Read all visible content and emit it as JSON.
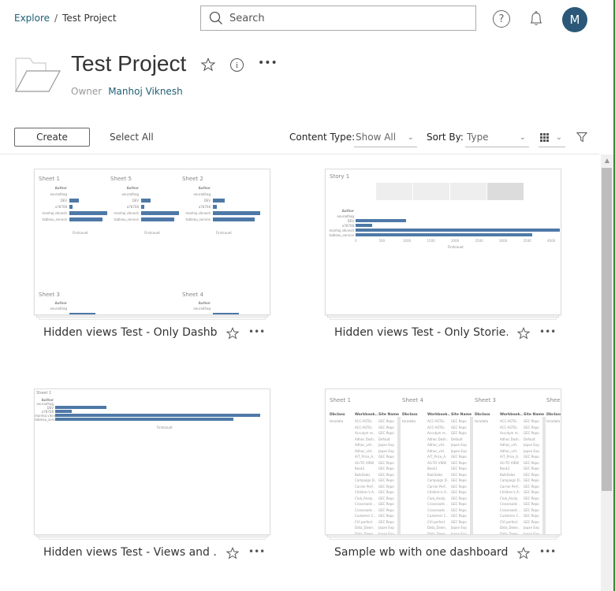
{
  "breadcrumb": {
    "root": "Explore",
    "separator": "/",
    "current": "Test Project"
  },
  "search": {
    "placeholder": "Search",
    "value": ""
  },
  "user": {
    "avatar_initial": "M",
    "avatar_color": "#2b5878"
  },
  "project": {
    "title": "Test Project",
    "owner_label": "Owner",
    "owner_name": "Manhoj Viknesh"
  },
  "toolbar": {
    "create_label": "Create",
    "select_all_label": "Select All",
    "content_type_label": "Content Type:",
    "content_type_value": "Show All",
    "sort_by_label": "Sort By:",
    "sort_by_value": "Type"
  },
  "accent_color": "#1f5f75",
  "bar_color": "#4e79a7",
  "workbooks": [
    {
      "title": "Hidden views Test - Only Dashb...",
      "thumb": {
        "sheets": [
          "Sheet 1",
          "Sheet 5",
          "Sheet 2",
          "Sheet 3",
          "Sheet 4"
        ],
        "axis_header": "Author",
        "categories": [
          "anuradhag",
          "DEV",
          "a78708",
          "manhoj.viknesh",
          "tableau_service"
        ],
        "axis_label": "Firstcount"
      }
    },
    {
      "title": "Hidden views Test - Only Storie...",
      "thumb": {
        "sheets": [
          "Story 1"
        ],
        "axis_header": "Author",
        "categories": [
          "anuradhag",
          "DEV",
          "a78708",
          "manhoj.viknesh",
          "tableau_service"
        ],
        "values": [
          0,
          1050,
          340,
          4250,
          3680
        ],
        "ticks": [
          "0",
          "500",
          "1000",
          "1500",
          "2000",
          "2500",
          "3000",
          "3500",
          "4000"
        ],
        "axis_label": "Firstcount"
      }
    },
    {
      "title": "Hidden views Test - Views and ...",
      "thumb": {
        "sheets": [
          "Sheet 1"
        ],
        "axis_header": "Author",
        "categories": [
          "anuradhag",
          "DEV",
          "a78708",
          "manhoj.viknesh",
          "tableau_service"
        ],
        "axis_label": "Firstcount"
      }
    },
    {
      "title": "Sample wb with one dashboard...",
      "thumb": {
        "sheets": [
          "Sheet 1",
          "Sheet 4",
          "Sheet 3",
          "Shee"
        ],
        "columns": [
          "Dbclass",
          "Workbook..",
          "Site Name"
        ],
        "dbclass": "teradata",
        "workbooks": [
          "ACC-ASTEr..",
          "ACC-ASTEr..",
          "Accutym re..",
          "Adhoc Dash..",
          "Adhoc_virt..",
          "Adhoc_virt..",
          "A/T_Price_A..",
          "AG-TO VIEW",
          "Book1",
          "BulkSales",
          "Campaign D..",
          "Carrier Perf..",
          "Children's A..",
          "Club_Analy..",
          "Crossroads ..",
          "Crossroads ..",
          "Customer C..",
          "CVI perfect",
          "Data_Down..",
          "Data_Down.."
        ],
        "sites": [
          "GEC Repo",
          "GEC Repo",
          "GEC Repo",
          "Default",
          "Japan Exp",
          "Japan Exp",
          "GEC Repo",
          "GEC Repo",
          "GEC Repo",
          "GEC Repo",
          "GEC Repo",
          "GEC Repo",
          "GEC Repo",
          "GEC Repo",
          "GEC Repo",
          "GEC Repo",
          "GEC Repo",
          "GEC Repo",
          "Japan Exp",
          "Japan Exp"
        ]
      }
    }
  ]
}
